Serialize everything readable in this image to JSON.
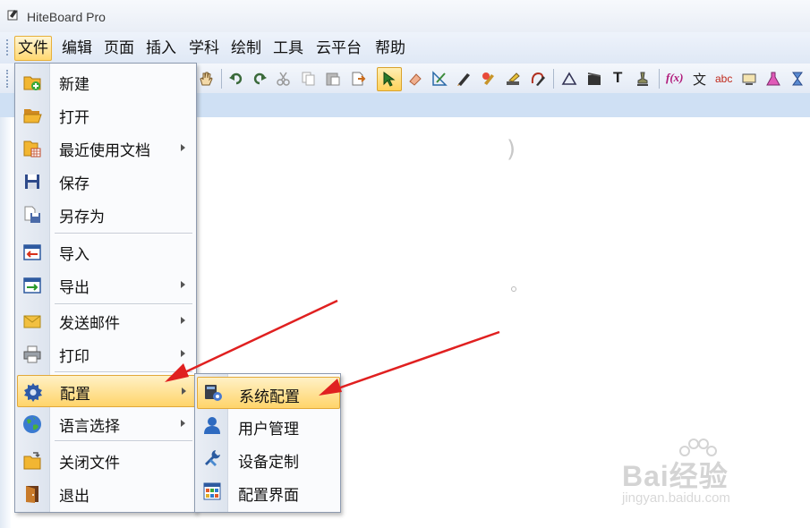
{
  "window": {
    "title": "HiteBoard Pro"
  },
  "menubar": [
    "文件",
    "编辑",
    "页面",
    "插入",
    "学科",
    "绘制",
    "工具",
    "云平台",
    "帮助"
  ],
  "file_menu": {
    "items": [
      {
        "label": "新建",
        "icon": "new-document-icon",
        "submenu": false
      },
      {
        "label": "打开",
        "icon": "open-folder-icon",
        "submenu": false
      },
      {
        "label": "最近使用文档",
        "icon": "recent-documents-icon",
        "submenu": true
      },
      {
        "label": "保存",
        "icon": "save-icon",
        "submenu": false
      },
      {
        "label": "另存为",
        "icon": "save-as-icon",
        "submenu": false
      },
      {
        "label": "导入",
        "icon": "import-icon",
        "submenu": false
      },
      {
        "label": "导出",
        "icon": "export-icon",
        "submenu": true
      },
      {
        "label": "发送邮件",
        "icon": "mail-icon",
        "submenu": true
      },
      {
        "label": "打印",
        "icon": "printer-icon",
        "submenu": true
      },
      {
        "label": "配置",
        "icon": "gear-icon",
        "submenu": true,
        "highlighted": true
      },
      {
        "label": "语言选择",
        "icon": "globe-icon",
        "submenu": true
      },
      {
        "label": "关闭文件",
        "icon": "close-file-icon",
        "submenu": false
      },
      {
        "label": "退出",
        "icon": "exit-door-icon",
        "submenu": false
      }
    ]
  },
  "config_submenu": {
    "items": [
      {
        "label": "系统配置",
        "icon": "system-config-icon",
        "highlighted": true
      },
      {
        "label": "用户管理",
        "icon": "user-icon"
      },
      {
        "label": "设备定制",
        "icon": "wrench-icon"
      },
      {
        "label": "配置界面",
        "icon": "layout-grid-icon"
      }
    ]
  },
  "toolbar": {
    "icons": [
      "hand-icon",
      "undo-icon",
      "redo-icon",
      "cut-icon",
      "copy-icon",
      "paste-icon",
      "insert-page-icon",
      "select-arrow-icon",
      "eraser-icon",
      "ruler-pen-icon",
      "pen-icon",
      "brush-icon",
      "highlighter-icon",
      "shape-pen-icon",
      "triangle-icon",
      "film-icon",
      "text-icon",
      "stamp-icon",
      "formula-icon",
      "chinese-text-icon",
      "abc-text-icon",
      "display-icon",
      "flask-icon",
      "hourglass-icon"
    ],
    "text_labels": {
      "text": "T",
      "formula": "f(x)",
      "chinese_text": "文",
      "abc": "abc"
    }
  },
  "watermark": {
    "brand": "Bai经验",
    "url": "jingyan.baidu.com"
  },
  "colors": {
    "highlight": "#ffd46a",
    "annotation_arrow": "#e02020"
  }
}
